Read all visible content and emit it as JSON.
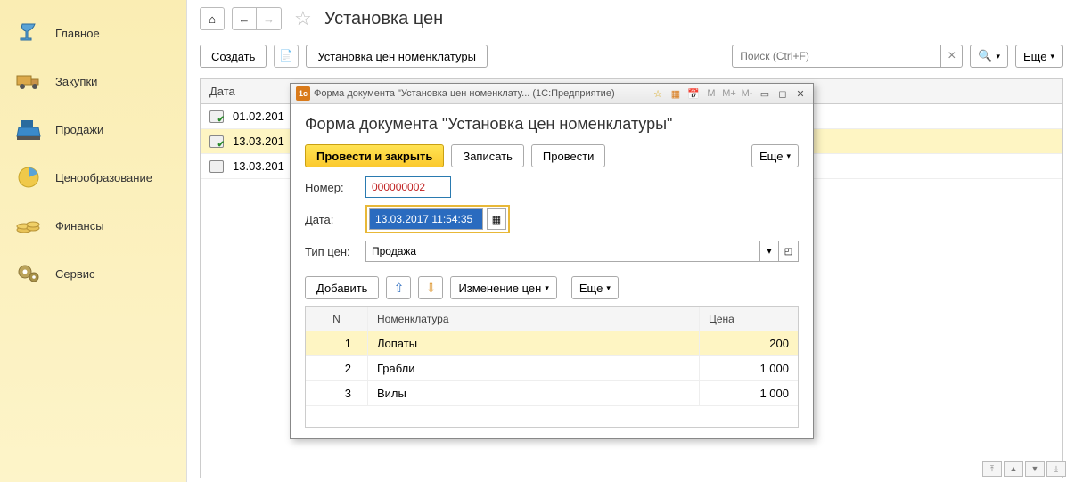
{
  "sidebar": {
    "items": [
      {
        "label": "Главное",
        "icon": "lamp"
      },
      {
        "label": "Закупки",
        "icon": "truck"
      },
      {
        "label": "Продажи",
        "icon": "register"
      },
      {
        "label": "Ценообразование",
        "icon": "pie"
      },
      {
        "label": "Финансы",
        "icon": "coins"
      },
      {
        "label": "Сервис",
        "icon": "gears"
      }
    ]
  },
  "page": {
    "title": "Установка цен"
  },
  "cmdbar": {
    "create": "Создать",
    "set_prices": "Установка цен номенклатуры",
    "search_placeholder": "Поиск (Ctrl+F)",
    "more": "Еще"
  },
  "list": {
    "header_date": "Дата",
    "rows": [
      {
        "date": "01.02.201",
        "posted": true
      },
      {
        "date": "13.03.201",
        "posted": true,
        "selected": true
      },
      {
        "date": "13.03.201",
        "posted": false
      }
    ]
  },
  "modal": {
    "window_title": "Форма документа \"Установка цен номенклату...  (1С:Предприятие)",
    "heading": "Форма документа \"Установка цен номенклатуры\"",
    "toolbar": {
      "post_close": "Провести и закрыть",
      "save": "Записать",
      "post": "Провести",
      "more": "Еще"
    },
    "fields": {
      "number_label": "Номер:",
      "number_value": "000000002",
      "date_label": "Дата:",
      "date_value": "13.03.2017 11:54:35",
      "type_label": "Тип цен:",
      "type_value": "Продажа"
    },
    "sub_toolbar": {
      "add": "Добавить",
      "change": "Изменение цен",
      "more": "Еще"
    },
    "grid": {
      "col_n": "N",
      "col_name": "Номенклатура",
      "col_price": "Цена",
      "rows": [
        {
          "n": "1",
          "name": "Лопаты",
          "price": "200",
          "selected": true
        },
        {
          "n": "2",
          "name": "Грабли",
          "price": "1 000"
        },
        {
          "n": "3",
          "name": "Вилы",
          "price": "1 000"
        }
      ]
    }
  }
}
